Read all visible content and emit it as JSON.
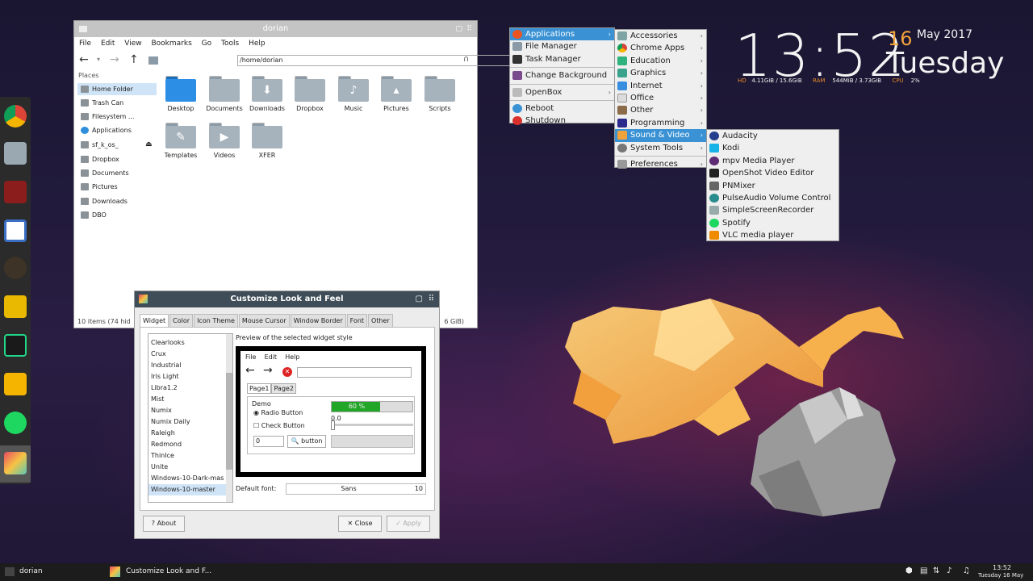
{
  "file_manager": {
    "title": "dorian",
    "menu": [
      "File",
      "Edit",
      "View",
      "Bookmarks",
      "Go",
      "Tools",
      "Help"
    ],
    "address": "/home/dorian",
    "places_header": "Places",
    "places": [
      "Home Folder",
      "Trash Can",
      "Filesystem ...",
      "Applications",
      "sf_k_os_",
      "Dropbox",
      "Documents",
      "Pictures",
      "Downloads",
      "DBO"
    ],
    "files": [
      "Desktop",
      "Documents",
      "Downloads",
      "Dropbox",
      "Music",
      "Pictures",
      "Scripts",
      "Templates",
      "Videos",
      "XFER"
    ],
    "status_left": "10 items (74 hid",
    "status_right": "6 GiB)"
  },
  "look_feel": {
    "title": "Customize Look and Feel",
    "tabs": [
      "Widget",
      "Color",
      "Icon Theme",
      "Mouse Cursor",
      "Window Border",
      "Font",
      "Other"
    ],
    "themes": [
      "Clearlooks",
      "Crux",
      "Industrial",
      "Iris Light",
      "Libra1.2",
      "Mist",
      "Numix",
      "Numix Daily",
      "Raleigh",
      "Redmond",
      "ThinIce",
      "Unite",
      "Windows-10-Dark-mas",
      "Windows-10-master"
    ],
    "preview_label": "Preview of the selected widget style",
    "preview": {
      "menu": [
        "File",
        "Edit",
        "Help"
      ],
      "page_tabs": [
        "Page1",
        "Page2"
      ],
      "demo_label": "Demo",
      "radio_label": "Radio Button",
      "check_label": "Check Button",
      "spin_value": "0",
      "button_label": "button",
      "progress_text": "60 %",
      "progress": 0.6,
      "slider_value": "0.0"
    },
    "default_font_label": "Default font:",
    "font_name": "Sans",
    "font_size": "10",
    "about": "About",
    "close": "Close",
    "apply": "Apply"
  },
  "root_menu": [
    "Applications",
    "File Manager",
    "Task Manager",
    "Change Background",
    "OpenBox",
    "Reboot",
    "Shutdown"
  ],
  "apps_menu": [
    "Accessories",
    "Chrome Apps",
    "Education",
    "Graphics",
    "Internet",
    "Office",
    "Other",
    "Programming",
    "Sound & Video",
    "System Tools",
    "Preferences"
  ],
  "sound_menu": [
    "Audacity",
    "Kodi",
    "mpv Media Player",
    "OpenShot Video Editor",
    "PNMixer",
    "PulseAudio Volume Control",
    "SimpleScreenRecorder",
    "Spotify",
    "VLC media player"
  ],
  "clock": {
    "time": "13:52",
    "day_num": "16",
    "month_year": "May 2017",
    "weekday": "Tuesday",
    "hd_label": "HD",
    "hd": "4.11GiB / 15.6GiB",
    "ram_label": "RAM",
    "ram": "544MiB / 3.73GiB",
    "cpu_label": "CPU",
    "cpu": "2%"
  },
  "taskbar": {
    "desktop": "dorian",
    "task": "Customize Look and F...",
    "time": "13:52",
    "date": "Tuesday 16 May"
  },
  "colors": {
    "accent": "#3a92d4",
    "clock_orange": "#f0a23c",
    "label_orange": "#e98a2a"
  }
}
